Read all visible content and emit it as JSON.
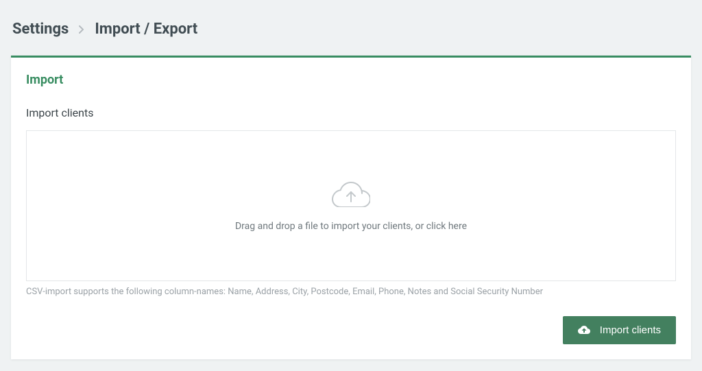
{
  "breadcrumb": {
    "root": "Settings",
    "current": "Import / Export"
  },
  "card": {
    "section_title": "Import",
    "sub_title": "Import clients",
    "dropzone_text": "Drag and drop a file to import your clients, or click here",
    "hint": "CSV-import supports the following column-names: Name, Address, City, Postcode, Email, Phone, Notes and Social Security Number",
    "button_label": "Import clients"
  }
}
